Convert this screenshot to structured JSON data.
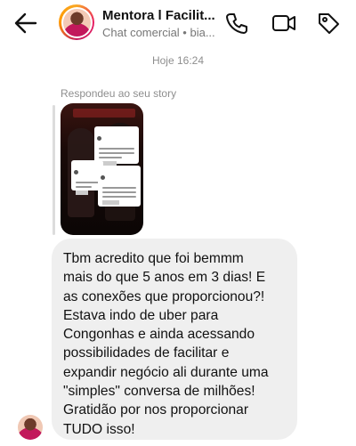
{
  "header": {
    "title": "Mentora l Facilit...",
    "subtitle": "Chat comercial • bia...",
    "icons": [
      "back-arrow-icon",
      "phone-icon",
      "video-call-icon",
      "tag-icon"
    ]
  },
  "conversation": {
    "timestamp": "Hoje 16:24",
    "reply_label": "Respondeu ao seu story",
    "message": "Tbm acredito que foi bemmm\nmais do que 5 anos em 3 dias! E\nas conexões que proporcionou?!\nEstava indo de uber para\nCongonhas e ainda acessando\npossibilidades de facilitar e\nexpandir negócio ali durante uma\n\"simples\" conversa de milhões!\nGratidão por nos proporcionar\nTUDO isso!"
  }
}
